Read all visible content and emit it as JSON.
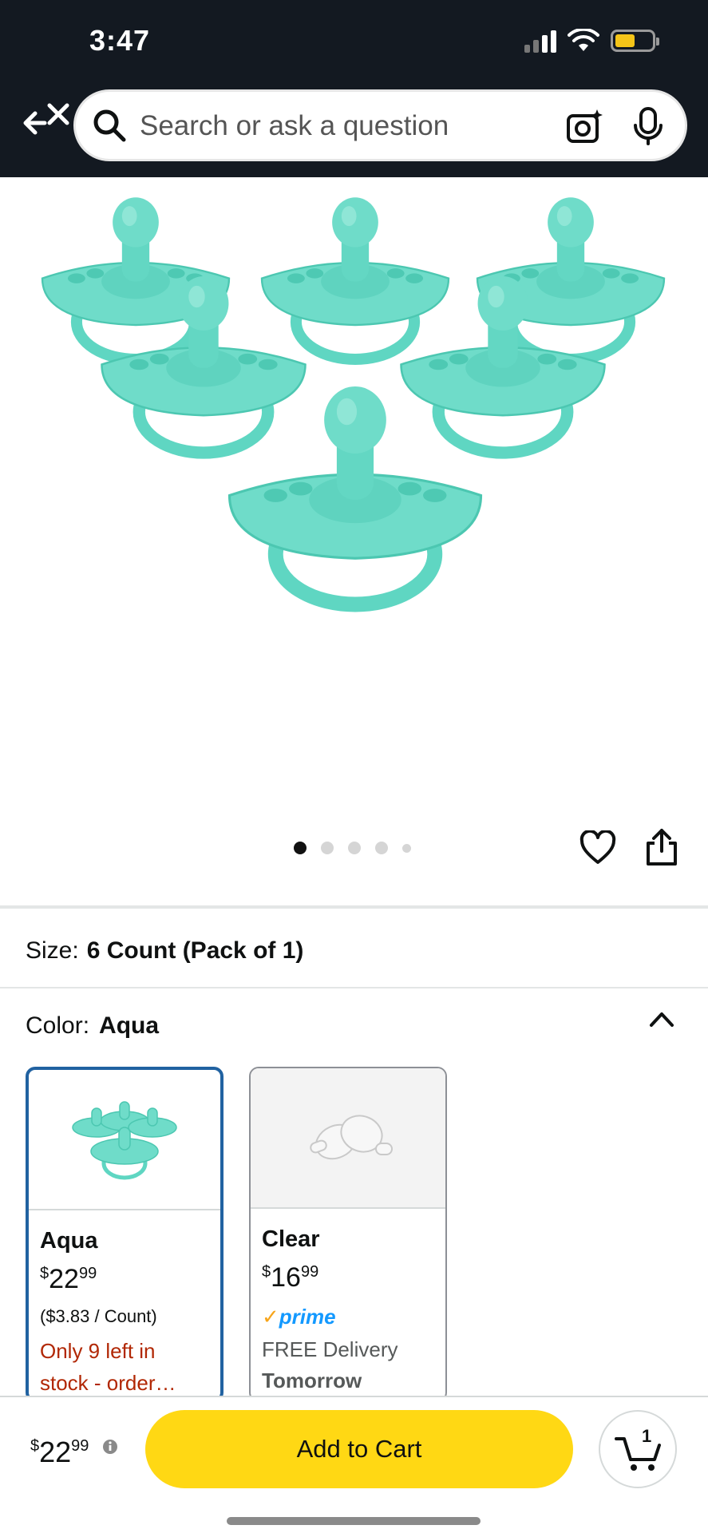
{
  "status_bar": {
    "time": "3:47",
    "battery_color": "#f5c518"
  },
  "header": {
    "back_icon": "back-close-icon",
    "search": {
      "placeholder": "Search or ask a question"
    },
    "camera_icon": "camera-sparkle-icon",
    "mic_icon": "microphone-icon",
    "background": "#131921"
  },
  "gallery": {
    "image_count": 5,
    "active_index": 0
  },
  "size": {
    "label": "Size:",
    "value": "6 Count (Pack of 1)"
  },
  "color": {
    "label": "Color:",
    "value": "Aqua"
  },
  "swatches": [
    {
      "name": "Aqua",
      "price_symbol": "$",
      "price_whole": "22",
      "price_cents": "99",
      "unit_price": "($3.83 / Count)",
      "stock_line1": "Only 9 left in",
      "stock_line2": "stock - order…",
      "selected": true
    },
    {
      "name": "Clear",
      "price_symbol": "$",
      "price_whole": "16",
      "price_cents": "99",
      "prime_label": "prime",
      "delivery": "FREE Delivery",
      "delivery_date": "Tomorrow",
      "selected": false
    }
  ],
  "bottom_bar": {
    "price_symbol": "$",
    "price_whole": "22",
    "price_cents": "99",
    "add_to_cart": "Add to Cart",
    "cart_count": "1",
    "button_color": "#ffd814"
  },
  "colors": {
    "accent_blue": "#2162a1",
    "stock_red": "#b12704",
    "prime_blue": "#1399ff",
    "product_aqua": "#5fd6c2"
  }
}
